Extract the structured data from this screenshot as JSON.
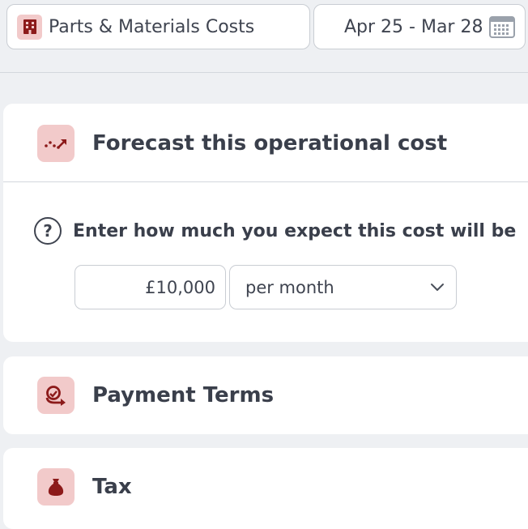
{
  "header": {
    "category_label": "Parts & Materials Costs",
    "category_icon": "building-icon",
    "date_range_label": "Apr 25 - Mar 28",
    "date_icon": "calendar-icon"
  },
  "forecast": {
    "title": "Forecast this operational cost",
    "icon": "trend-up-icon",
    "question": "Enter how much you expect this cost will be",
    "question_icon": "help-icon",
    "question_mark": "?",
    "amount_value": "£10,000",
    "period_value": "per month",
    "period_icon": "chevron-down-icon"
  },
  "payment_terms": {
    "title": "Payment Terms",
    "icon": "payment-terms-icon"
  },
  "tax": {
    "title": "Tax",
    "icon": "money-bag-icon"
  },
  "colors": {
    "icon_badge_bg": "#f2caca",
    "icon_color": "#8c1a1a",
    "page_bg": "#eef0f3",
    "text": "#3a3f4b"
  }
}
